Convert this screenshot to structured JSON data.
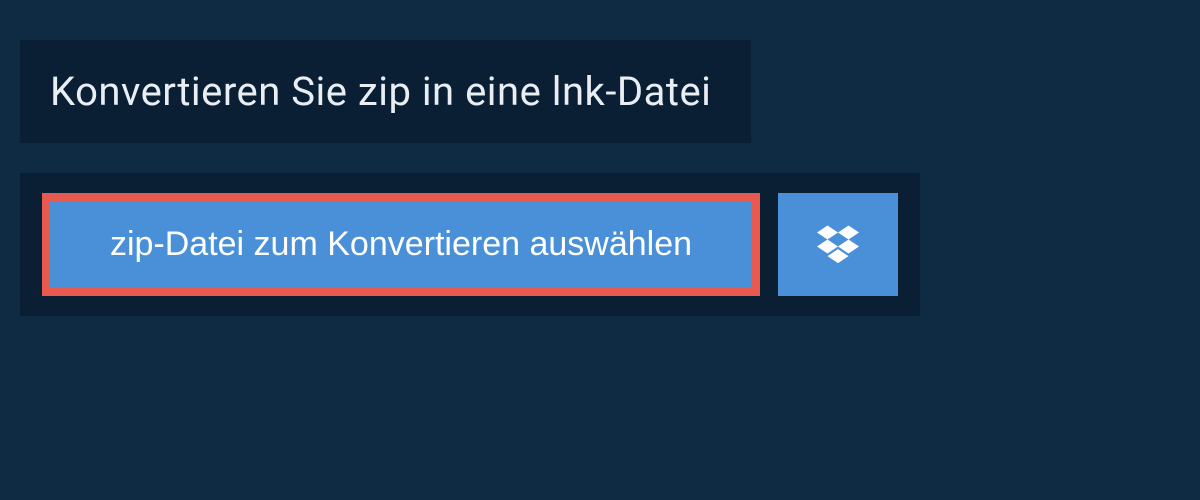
{
  "header": {
    "title": "Konvertieren Sie zip in eine lnk-Datei"
  },
  "upload": {
    "choose_file_label": "zip-Datei zum Konvertieren auswählen",
    "dropbox_icon": "dropbox-icon"
  }
}
